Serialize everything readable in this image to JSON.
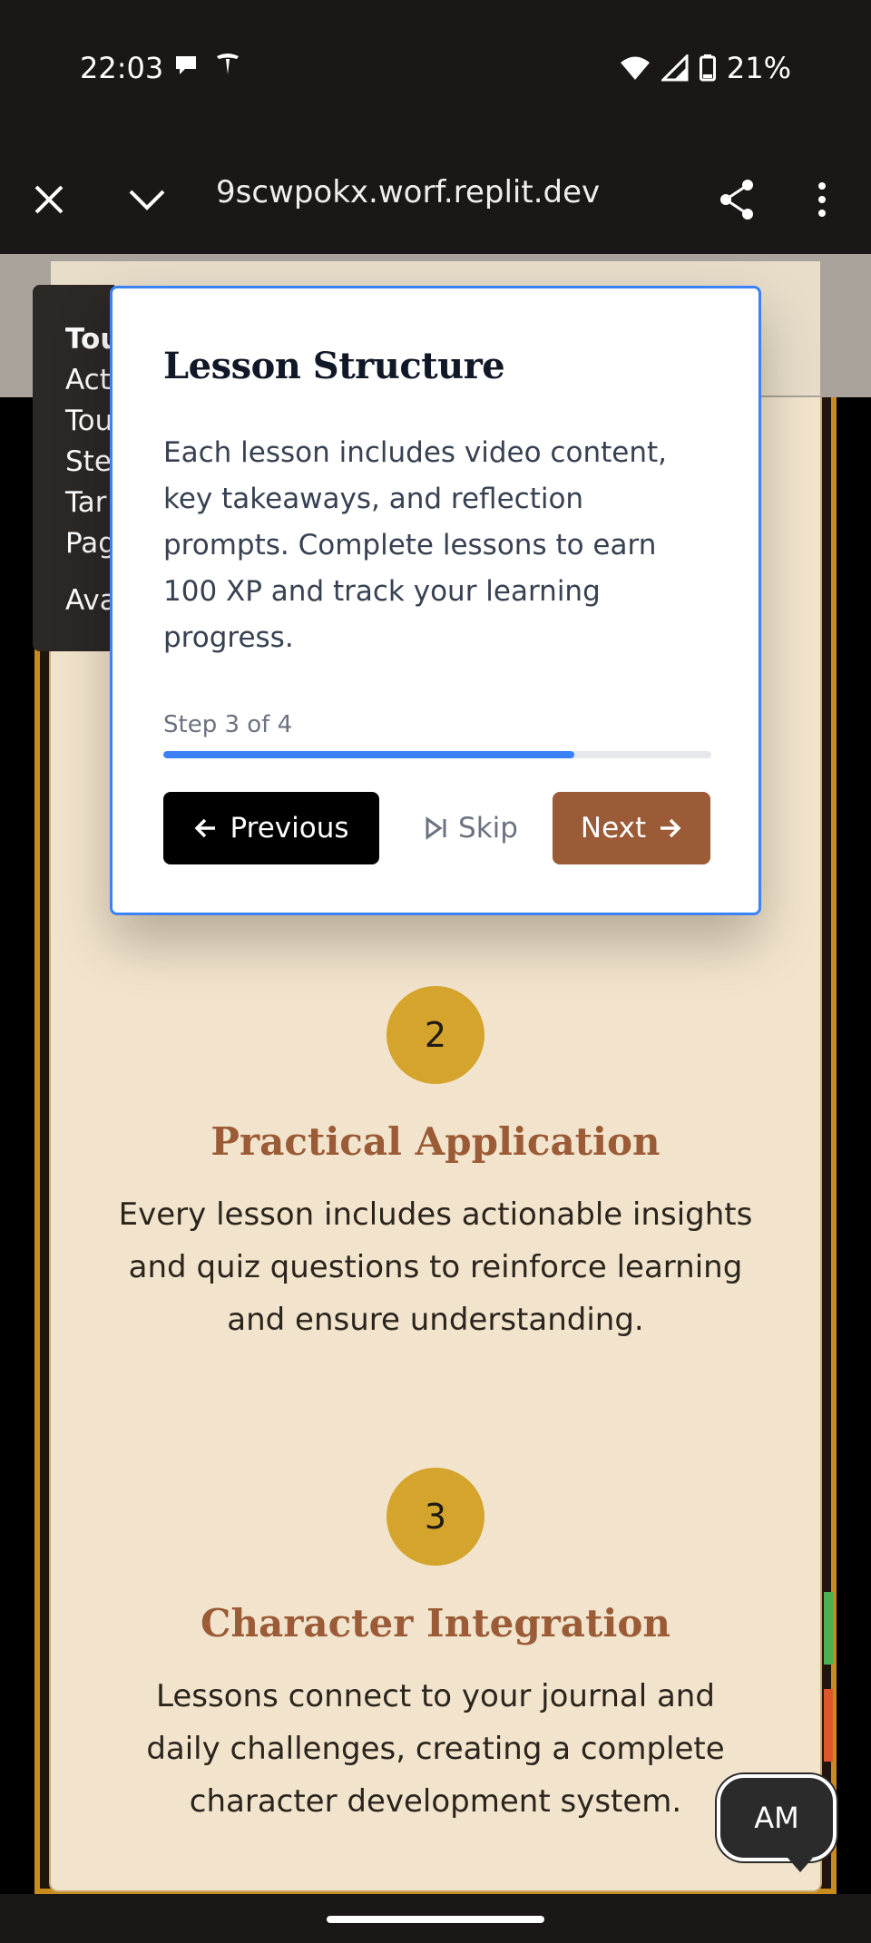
{
  "status_bar": {
    "time": "22:03",
    "battery": "21%",
    "icons": [
      "chat-bubble-icon",
      "tesla-icon",
      "wifi-icon",
      "signal-icon",
      "battery-icon"
    ]
  },
  "browser": {
    "url": "9scwpokx.worf.replit.dev",
    "icons": [
      "close-icon",
      "chevron-down-icon",
      "share-icon",
      "more-vert-icon"
    ]
  },
  "tour_debug": {
    "lines": [
      "Tou",
      "Act",
      "Tou",
      "Ste",
      "Tar",
      "Pag",
      "",
      "Ava"
    ]
  },
  "modal": {
    "title": "Lesson Structure",
    "body": "Each lesson includes video content, key takeaways, and reflection prompts. Complete lessons to earn 100 XP and track your learning progress.",
    "step_label": "Step 3 of 4",
    "progress": 0.75,
    "previous_label": "Previous",
    "skip_label": "Skip",
    "next_label": "Next"
  },
  "features": [
    {
      "number": "2",
      "title": "Practical Application",
      "description": "Every lesson includes actionable insights and quiz questions to reinforce learning and ensure understanding."
    },
    {
      "number": "3",
      "title": "Character Integration",
      "description": "Lessons connect to your journal and daily challenges, creating a complete character development system."
    }
  ],
  "avatar": {
    "initials": "AM"
  },
  "colors": {
    "accent_blue": "#3b82f6",
    "brand_brown": "#9a5b36",
    "gold": "#d4a42c",
    "card_bg": "#f2e4cc"
  }
}
